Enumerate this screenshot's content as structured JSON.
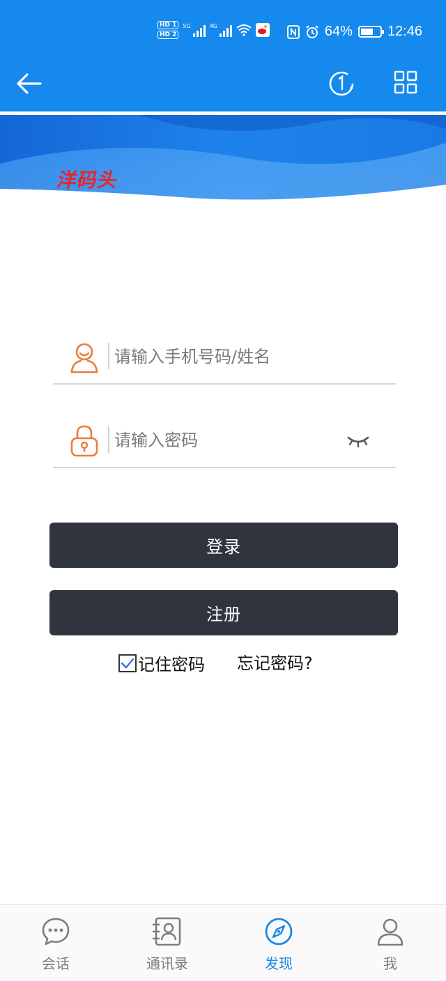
{
  "status_bar": {
    "hd_top": "HD 1",
    "hd_bottom": "HD 2",
    "signal1": "5G",
    "signal2": "4G",
    "battery": "64%",
    "battery_level": 0.64,
    "time": "12:46"
  },
  "banner": {
    "brand": "洋码头"
  },
  "form": {
    "username_placeholder": "请输入手机号码/姓名",
    "password_placeholder": "请输入密码",
    "login_label": "登录",
    "register_label": "注册",
    "remember_label": "记住密码",
    "remember_checked": true,
    "forgot_label": "忘记密码?"
  },
  "bottom_nav": {
    "items": [
      {
        "label": "会话",
        "icon": "chat-bubble-icon"
      },
      {
        "label": "通讯录",
        "icon": "contacts-icon"
      },
      {
        "label": "发现",
        "icon": "compass-icon",
        "active": true
      },
      {
        "label": "我",
        "icon": "person-icon"
      }
    ]
  },
  "colors": {
    "app_bar": "#1589ee",
    "button_dark": "#30343f",
    "icon_orange": "#ec7a3c",
    "nav_active": "#1a87e6",
    "nav_inactive": "#7d7d7d",
    "brand_red": "#e8262a"
  }
}
